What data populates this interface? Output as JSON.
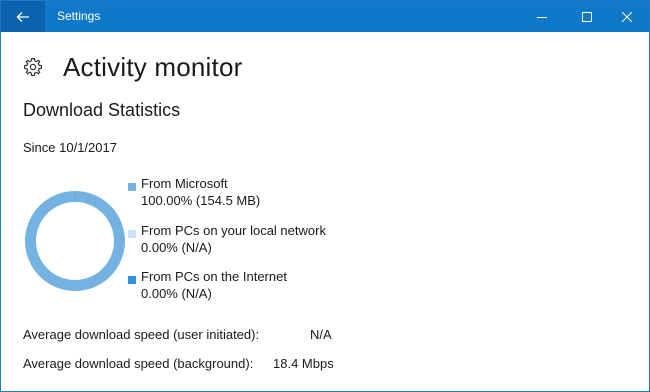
{
  "window": {
    "title": "Settings"
  },
  "page": {
    "title": "Activity monitor",
    "section_title": "Download Statistics",
    "since": "Since 10/1/2017"
  },
  "chart_data": {
    "type": "pie",
    "categories": [
      "From Microsoft",
      "From PCs on your local network",
      "From PCs on the Internet"
    ],
    "values": [
      100.0,
      0.0,
      0.0
    ],
    "title": "",
    "colors": [
      "#74b3e1",
      "#c8e1f3",
      "#2c8fd7"
    ]
  },
  "legend": [
    {
      "name": "From Microsoft",
      "value": "100.00%  (154.5 MB)",
      "color": "#74b3e1"
    },
    {
      "name": "From PCs on your local network",
      "value": "0.00%  (N/A)",
      "color": "#c8e1f3"
    },
    {
      "name": "From PCs on the Internet",
      "value": "0.00%  (N/A)",
      "color": "#2c8fd7"
    }
  ],
  "stats": {
    "user_label": "Average download speed (user initiated):",
    "user_value": "N/A",
    "background_label": "Average download speed (background):",
    "background_value": "18.4 Mbps"
  },
  "icons": {
    "back": "arrow-left-icon",
    "minimize": "minimize-icon",
    "maximize": "maximize-icon",
    "close": "close-icon",
    "page": "gear-icon"
  }
}
